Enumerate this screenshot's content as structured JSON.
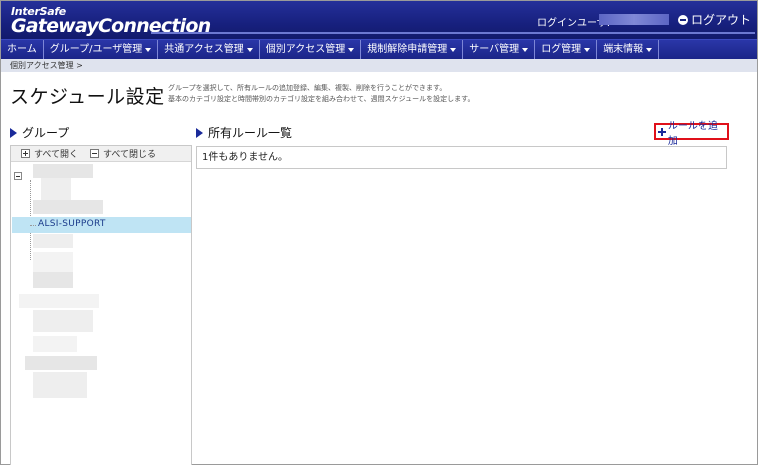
{
  "header": {
    "logo_top": "InterSafe",
    "logo_main": "GatewayConnection",
    "login_label": "ログインユーザ:",
    "logout_label": "ログアウト"
  },
  "nav": {
    "items": [
      {
        "label": "ホーム",
        "dropdown": false
      },
      {
        "label": "グループ/ユーザ管理",
        "dropdown": true
      },
      {
        "label": "共通アクセス管理",
        "dropdown": true
      },
      {
        "label": "個別アクセス管理",
        "dropdown": true
      },
      {
        "label": "規制解除申請管理",
        "dropdown": true
      },
      {
        "label": "サーバ管理",
        "dropdown": true
      },
      {
        "label": "ログ管理",
        "dropdown": true
      },
      {
        "label": "端末情報",
        "dropdown": true
      }
    ]
  },
  "breadcrumb": "個別アクセス管理 >",
  "page": {
    "title": "スケジュール設定",
    "desc_line1": "グループを選択して、所有ルールの追加登録、編集、複製、削除を行うことができます。",
    "desc_line2": "基本のカテゴリ設定と時間帯別のカテゴリ設定を組み合わせて、週間スケジュールを設定します。"
  },
  "group_panel": {
    "title": "グループ",
    "expand_all": "すべて開く",
    "collapse_all": "すべて閉じる",
    "selected_group": "ALSI-SUPPORT"
  },
  "rules_panel": {
    "title": "所有ルール一覧",
    "add_rule": "ルールを追加",
    "empty_message": "1件もありません。"
  },
  "colors": {
    "header_bg": "#1b2588",
    "highlight_border": "#e0101a",
    "selected_row": "#bfe4f4"
  }
}
